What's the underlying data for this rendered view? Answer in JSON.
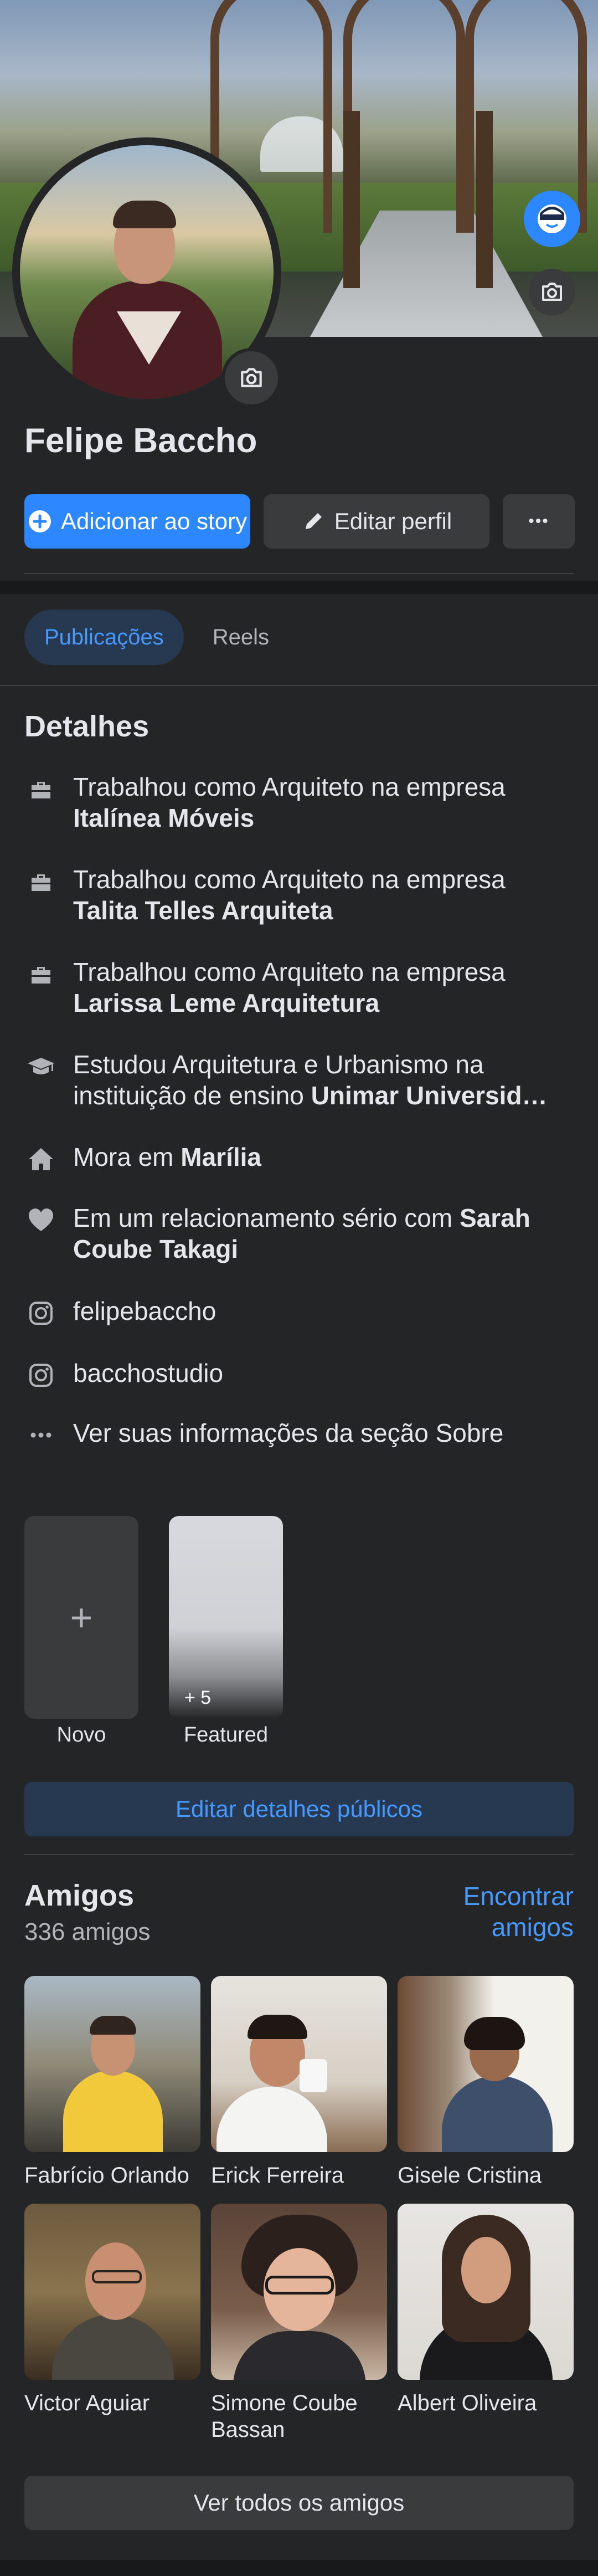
{
  "profile": {
    "name": "Felipe Baccho"
  },
  "actions": {
    "add_story": "Adicionar ao story",
    "edit_profile": "Editar perfil",
    "more": "•••"
  },
  "tabs": [
    {
      "label": "Publicações",
      "active": true
    },
    {
      "label": "Reels",
      "active": false
    }
  ],
  "details": {
    "title": "Detalhes",
    "work": [
      {
        "prefix": "Trabalhou como Arquiteto na empresa",
        "company": "Italínea Móveis"
      },
      {
        "prefix": "Trabalhou como Arquiteto na empresa",
        "company": "Talita Telles Arquiteta"
      },
      {
        "prefix": "Trabalhou como Arquiteto na empresa",
        "company": "Larissa Leme Arquitetura"
      }
    ],
    "education": {
      "line1": "Estudou Arquitetura e Urbanismo na",
      "line2_prefix": "instituição de ensino",
      "school": "Unimar Universid…"
    },
    "lives": {
      "prefix": "Mora em",
      "city": "Marília"
    },
    "relationship": {
      "prefix": "Em um relacionamento sério com",
      "partner": "Sarah Coube Takagi"
    },
    "instagram": [
      "felipebaccho",
      "bacchostudio"
    ],
    "see_about": "Ver suas informações da seção Sobre"
  },
  "featured": {
    "new_label": "Novo",
    "plus": "+",
    "featured_label": "Featured",
    "featured_count": "+ 5"
  },
  "edit_public_details": "Editar detalhes públicos",
  "friends": {
    "title": "Amigos",
    "count": "336 amigos",
    "find": "Encontrar amigos",
    "list": [
      {
        "name": "Fabrício Orlando"
      },
      {
        "name": "Erick Ferreira"
      },
      {
        "name": "Gisele Cristina"
      },
      {
        "name": "Victor Aguiar"
      },
      {
        "name": "Simone Coube Bassan"
      },
      {
        "name": "Albert Oliveira"
      }
    ],
    "see_all": "Ver todos os amigos"
  },
  "colors": {
    "background": "#242526",
    "accent": "#2d88ff",
    "accent_soft": "#263951",
    "link": "#4599ff",
    "button_grey": "#3a3b3c",
    "text_primary": "#e4e6eb",
    "text_secondary": "#b0b3b8"
  },
  "icons": {
    "cover_avatar": "avatar-icon",
    "camera": "camera-icon",
    "plus_circle": "plus-circle-icon",
    "pencil": "pencil-icon",
    "work": "briefcase-icon",
    "education": "graduation-cap-icon",
    "home": "home-icon",
    "relationship": "heart-icon",
    "instagram": "instagram-icon",
    "more": "ellipsis-icon"
  }
}
